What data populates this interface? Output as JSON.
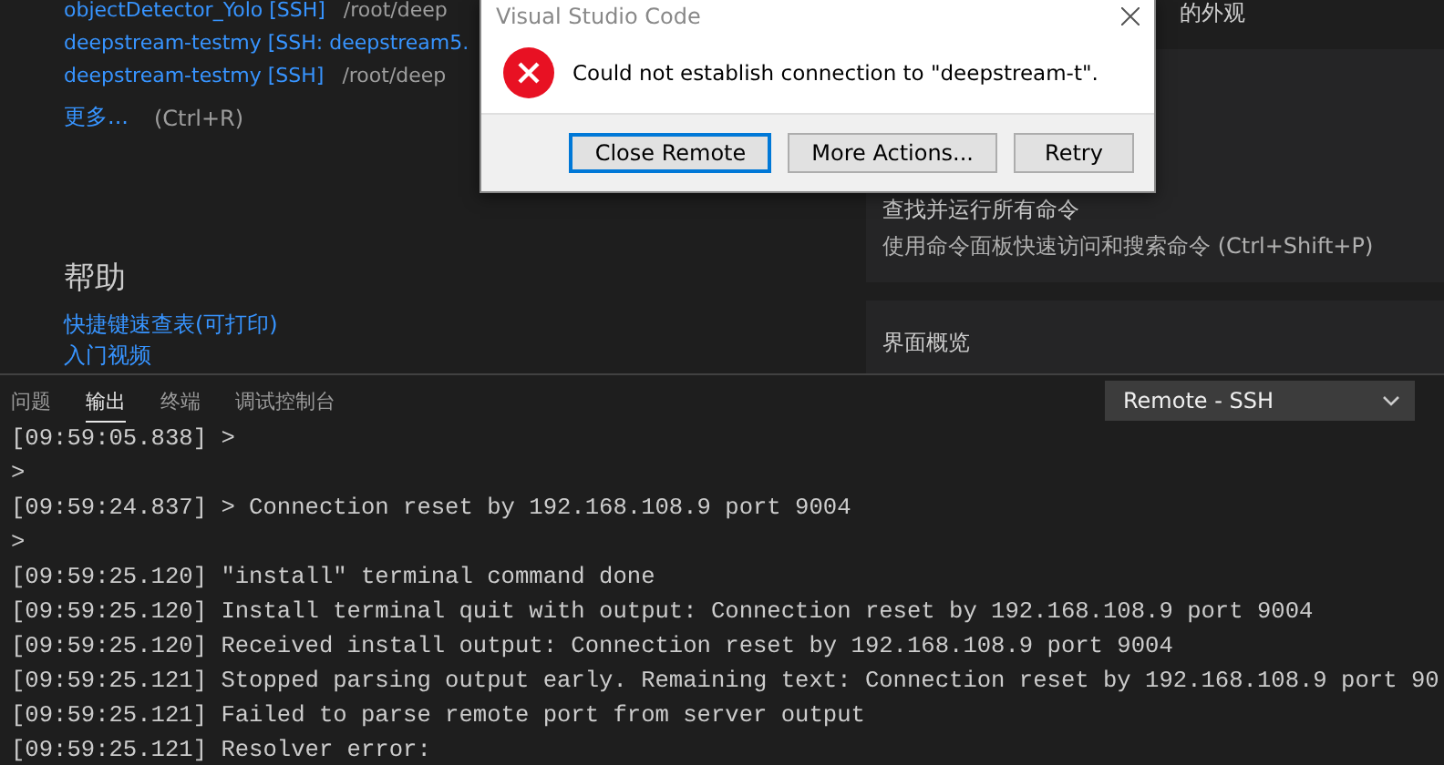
{
  "welcome": {
    "recent": [
      {
        "name": "objectDetector_Yolo [SSH]",
        "path": "/root/deep"
      },
      {
        "name": "deepstream-testmy [SSH: deepstream5."
      },
      {
        "name": "deepstream-testmy [SSH]",
        "path": "/root/deep"
      }
    ],
    "more": {
      "label": "更多...",
      "shortcut": "(Ctrl+R)"
    },
    "help": {
      "title": "帮助",
      "links": [
        "快捷键速查表(可打印)",
        "入门视频"
      ]
    },
    "right_fragment": "的外观",
    "cards": [
      {
        "title": "查找并运行所有命令",
        "description": "使用命令面板快速访问和搜索命令 (Ctrl+Shift+P)"
      },
      {
        "title": "界面概览"
      }
    ]
  },
  "dialog": {
    "title": "Visual Studio Code",
    "message": "Could not establish connection to \"deepstream-t\".",
    "buttons": [
      {
        "label": "Close Remote",
        "focused": true
      },
      {
        "label": "More Actions...",
        "focused": false
      },
      {
        "label": "Retry",
        "focused": false
      }
    ]
  },
  "panel": {
    "tabs": [
      {
        "label": "问题",
        "selected": false
      },
      {
        "label": "输出",
        "selected": true
      },
      {
        "label": "终端",
        "selected": false
      },
      {
        "label": "调试控制台",
        "selected": false
      }
    ],
    "channel": "Remote - SSH",
    "output": [
      "[09:59:05.838] >",
      ">",
      "[09:59:24.837] > Connection reset by 192.168.108.9 port 9004",
      ">",
      "[09:59:25.120] \"install\" terminal command done",
      "[09:59:25.120] Install terminal quit with output: Connection reset by 192.168.108.9 port 9004",
      "[09:59:25.120] Received install output: Connection reset by 192.168.108.9 port 9004",
      "[09:59:25.121] Stopped parsing output early. Remaining text: Connection reset by 192.168.108.9 port 90",
      "[09:59:25.121] Failed to parse remote port from server output",
      "[09:59:25.121] Resolver error:"
    ]
  }
}
